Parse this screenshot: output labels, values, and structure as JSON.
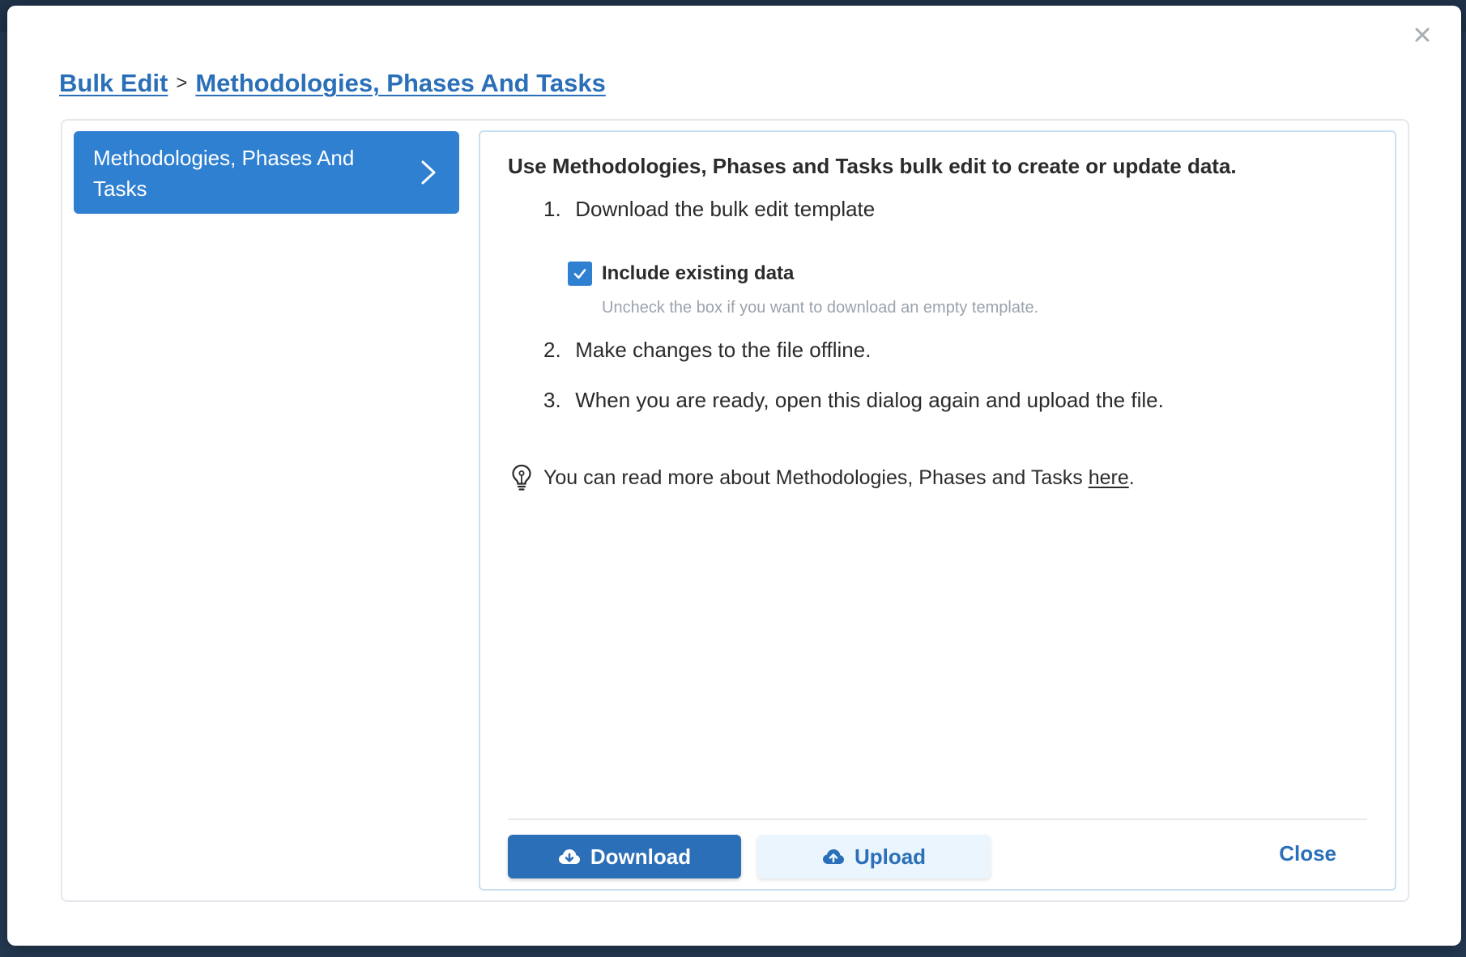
{
  "modal": {
    "breadcrumb": {
      "root": "Bulk Edit",
      "separator": ">",
      "current": "Methodologies, Phases And Tasks"
    },
    "sidebar": {
      "items": [
        {
          "label": "Methodologies, Phases And Tasks",
          "selected": true
        }
      ]
    },
    "content": {
      "intro": "Use Methodologies, Phases and Tasks bulk edit to create or update data.",
      "steps": [
        {
          "number": "1.",
          "text": "Download the bulk edit template"
        },
        {
          "number": "2.",
          "text": "Make changes to the file offline."
        },
        {
          "number": "3.",
          "text": "When you are ready, open this dialog again and upload the file."
        }
      ],
      "include_existing": {
        "label": "Include existing data",
        "checked": true,
        "hint": "Uncheck the box if you want to download an empty template."
      },
      "info": {
        "text_before": "You can read more about Methodologies, Phases and Tasks",
        "link": "here",
        "text_after": "."
      }
    },
    "footer": {
      "download_label": "Download",
      "upload_label": "Upload",
      "close_label": "Close"
    }
  },
  "colors": {
    "accent": "#2f80d1",
    "link": "#2a6fb8",
    "upload_bg": "#eaf5fd"
  }
}
